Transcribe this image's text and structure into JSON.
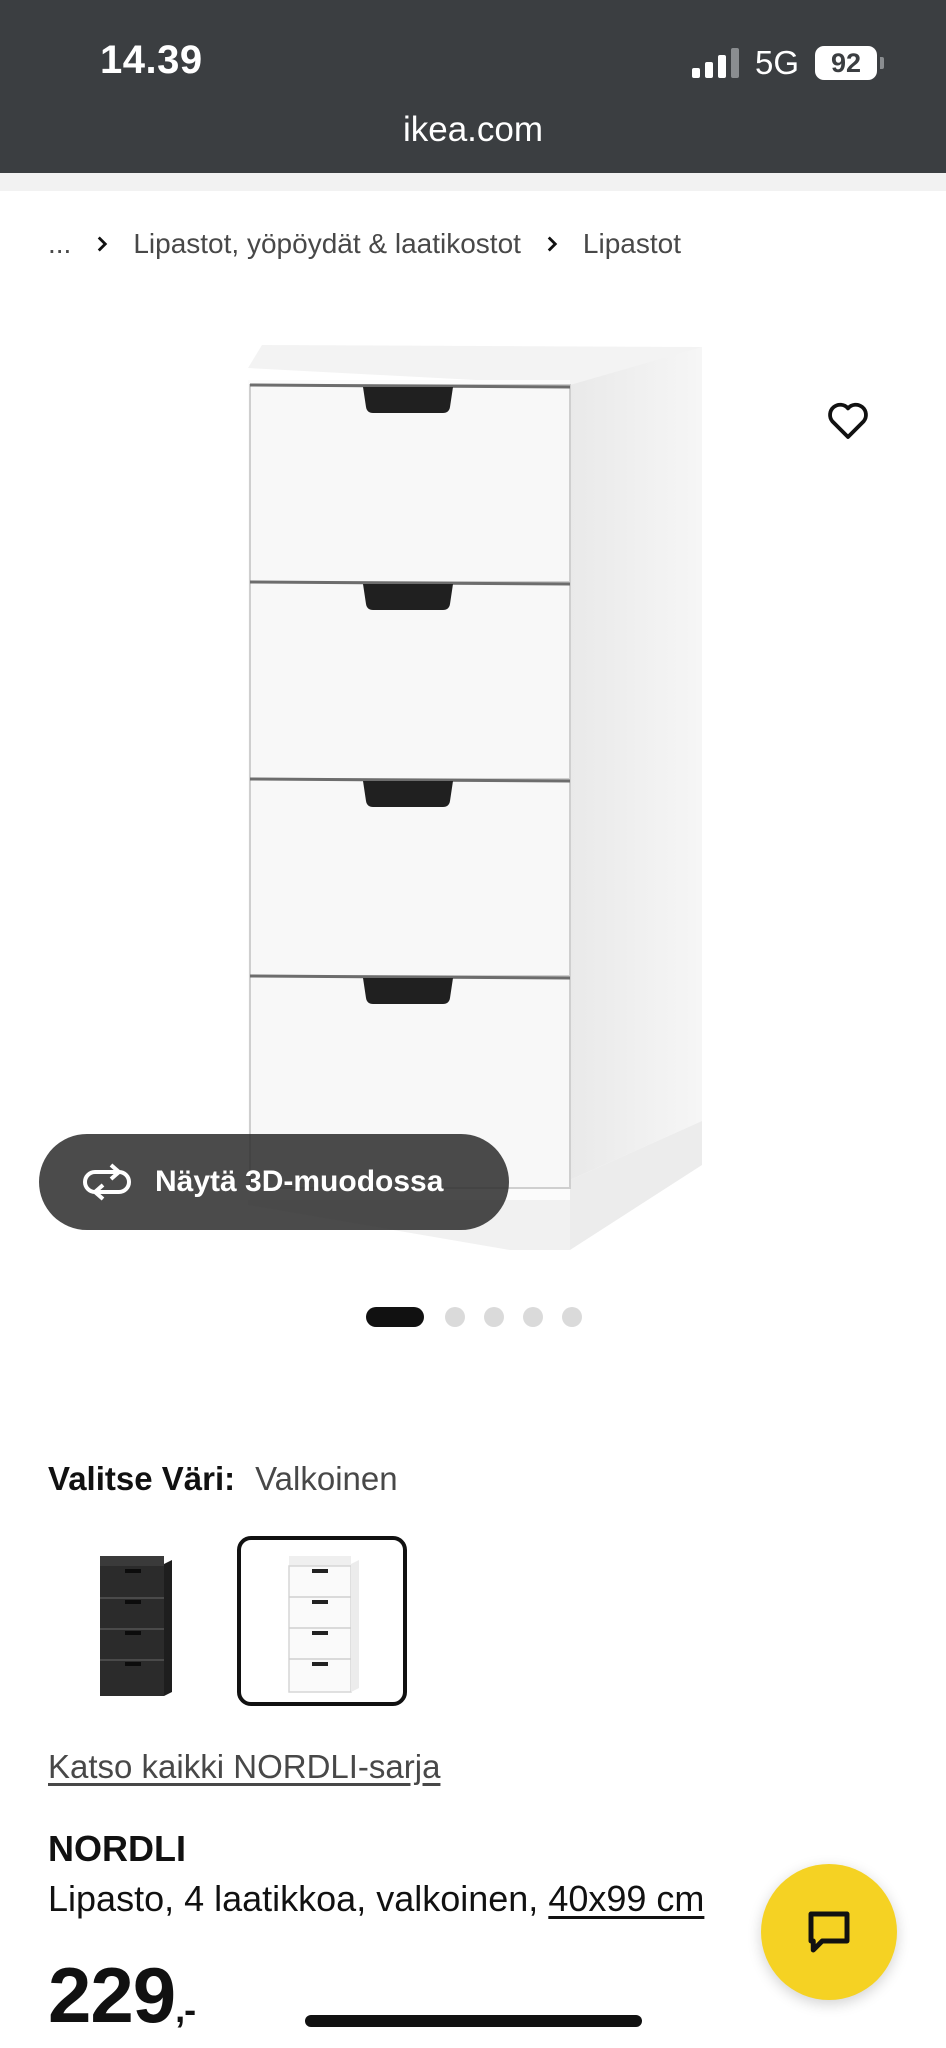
{
  "status_bar": {
    "time": "14.39",
    "network": "5G",
    "battery": "92"
  },
  "browser": {
    "url": "ikea.com"
  },
  "breadcrumb": {
    "ellipsis": "...",
    "items": [
      {
        "label": "Lipastot, yöpöydät & laatikostot"
      },
      {
        "label": "Lipastot"
      }
    ]
  },
  "gallery": {
    "view_3d_label": "Näytä 3D-muodossa",
    "image_count": 5,
    "active_index": 0
  },
  "color_selector": {
    "label": "Valitse Väri:",
    "selected_value": "Valkoinen",
    "options": [
      {
        "color": "#2b2b2b",
        "selected": false
      },
      {
        "color": "#ffffff",
        "selected": true
      }
    ]
  },
  "series_link": "Katso kaikki NORDLI-sarja",
  "product": {
    "name": "NORDLI",
    "description": "Lipasto, 4 laatikkoa, valkoinen, ",
    "dimensions": "40x99 cm",
    "price": "229",
    "price_suffix": ",-"
  },
  "colors": {
    "top_bar": "#3b3e41",
    "chat_button": "#f5d223",
    "text": "#111111"
  }
}
